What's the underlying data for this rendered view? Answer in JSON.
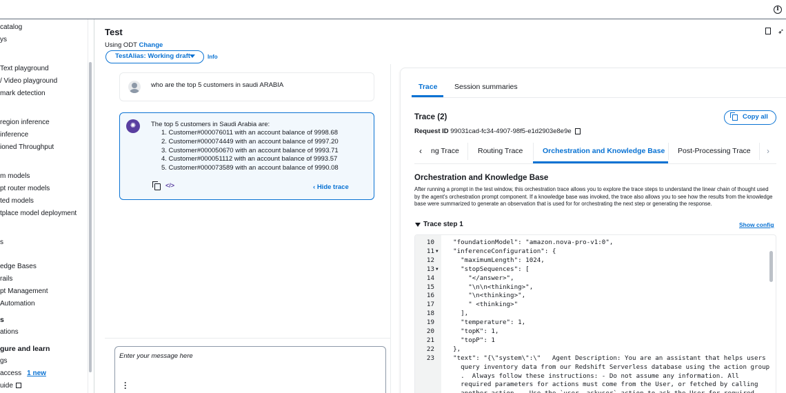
{
  "left_nav": {
    "items": [
      {
        "label": "catalog",
        "y": 0
      },
      {
        "label": "ys",
        "y": 1
      },
      {
        "label": "Text playground",
        "y": 2
      },
      {
        "label": "/ Video playground",
        "y": 3
      },
      {
        "label": "mark detection",
        "y": 4
      },
      {
        "label": "region inference",
        "y": 5
      },
      {
        "label": "inference",
        "y": 6
      },
      {
        "label": "ioned Throughput",
        "y": 7
      },
      {
        "label": "m models",
        "y": 8
      },
      {
        "label": "pt router models",
        "y": 9
      },
      {
        "label": "ted models",
        "y": 10
      },
      {
        "label": "tplace model deployment",
        "y": 11
      },
      {
        "label": "s",
        "y": 12
      },
      {
        "label": "edge Bases",
        "y": 13
      },
      {
        "label": "rails",
        "y": 14
      },
      {
        "label": "pt Management",
        "y": 15
      },
      {
        "label": "Automation",
        "y": 16
      },
      {
        "label": "s",
        "y": 17
      },
      {
        "label": "ations",
        "y": 18
      },
      {
        "label": "gure and learn",
        "y": 19
      },
      {
        "label": "gs",
        "y": 20
      },
      {
        "label": "access",
        "y": 21
      },
      {
        "label": "uide",
        "y": 22
      }
    ],
    "new_badge": "1 new"
  },
  "test_panel": {
    "title": "Test",
    "using_prefix": "Using ODT",
    "change_link": "Change",
    "alias_select": "TestAlias: Working draft",
    "info_link": "Info"
  },
  "chat": {
    "user_message": "who are the top 5 customers in saudi ARABIA",
    "agent_intro": "The top 5 customers in Saudi Arabia are:",
    "agent_list": [
      "1. Customer#000076011 with an account balance of 9998.68",
      "2. Customer#000074449 with an account balance of 9997.20",
      "3. Customer#000050670 with an account balance of 9993.71",
      "4. Customer#000051112 with an account balance of 9993.57",
      "5. Customer#000073589 with an account balance of 9990.08"
    ],
    "hide_trace": "Hide trace",
    "input_placeholder": "Enter your message here"
  },
  "trace_panel": {
    "tabs": [
      "Trace",
      "Session summaries"
    ],
    "trace_title": "Trace (2)",
    "copy_all": "Copy all",
    "request_id_label": "Request ID",
    "request_id": "99031cad-fc34-4907-98f5-e1d2903e8e9e",
    "subtabs": [
      "ng Trace",
      "Routing Trace",
      "Orchestration and Knowledge Base",
      "Post-Processing Trace"
    ],
    "section_title": "Orchestration and Knowledge Base",
    "section_desc": "After running a prompt in the test window, this orchestration trace allows you to explore the trace steps to understand the linear chain of thought used by the agent's orchestration prompt component. If a knowledge base was invoked, the trace also allows you to see how the results from the knowledge base were summarized to generate an observation that is used for for orchestrating the next step or generating the response.",
    "step_label": "Trace step 1",
    "show_config": "Show config"
  },
  "code": [
    {
      "n": "10",
      "fold": "",
      "t": "  \"foundationModel\": \"amazon.nova-pro-v1:0\","
    },
    {
      "n": "11",
      "fold": "▼",
      "t": "  \"inferenceConfiguration\": {"
    },
    {
      "n": "12",
      "fold": "",
      "t": "    \"maximumLength\": 1024,"
    },
    {
      "n": "13",
      "fold": "▼",
      "t": "    \"stopSequences\": ["
    },
    {
      "n": "14",
      "fold": "",
      "t": "      \"</answer>\","
    },
    {
      "n": "15",
      "fold": "",
      "t": "      \"\\n\\n<thinking>\","
    },
    {
      "n": "16",
      "fold": "",
      "t": "      \"\\n<thinking>\","
    },
    {
      "n": "17",
      "fold": "",
      "t": "      \" <thinking>\""
    },
    {
      "n": "18",
      "fold": "",
      "t": "    ],"
    },
    {
      "n": "19",
      "fold": "",
      "t": "    \"temperature\": 1,"
    },
    {
      "n": "20",
      "fold": "",
      "t": "    \"topK\": 1,"
    },
    {
      "n": "21",
      "fold": "",
      "t": "    \"topP\": 1"
    },
    {
      "n": "22",
      "fold": "",
      "t": "  },"
    },
    {
      "n": "23",
      "fold": "",
      "t": "  \"text\": \"{\\\"system\\\":\\\"   Agent Description: You are an assistant that helps users"
    },
    {
      "n": "",
      "fold": "",
      "t": "    query inventory data from our Redshift Serverless database using the action group"
    },
    {
      "n": "",
      "fold": "",
      "t": "    .  Always follow these instructions: - Do not assume any information. All"
    },
    {
      "n": "",
      "fold": "",
      "t": "    required parameters for actions must come from the User, or fetched by calling"
    },
    {
      "n": "",
      "fold": "",
      "t": "    another action. - Use the `user__askuser` action to ask the User for required"
    }
  ]
}
